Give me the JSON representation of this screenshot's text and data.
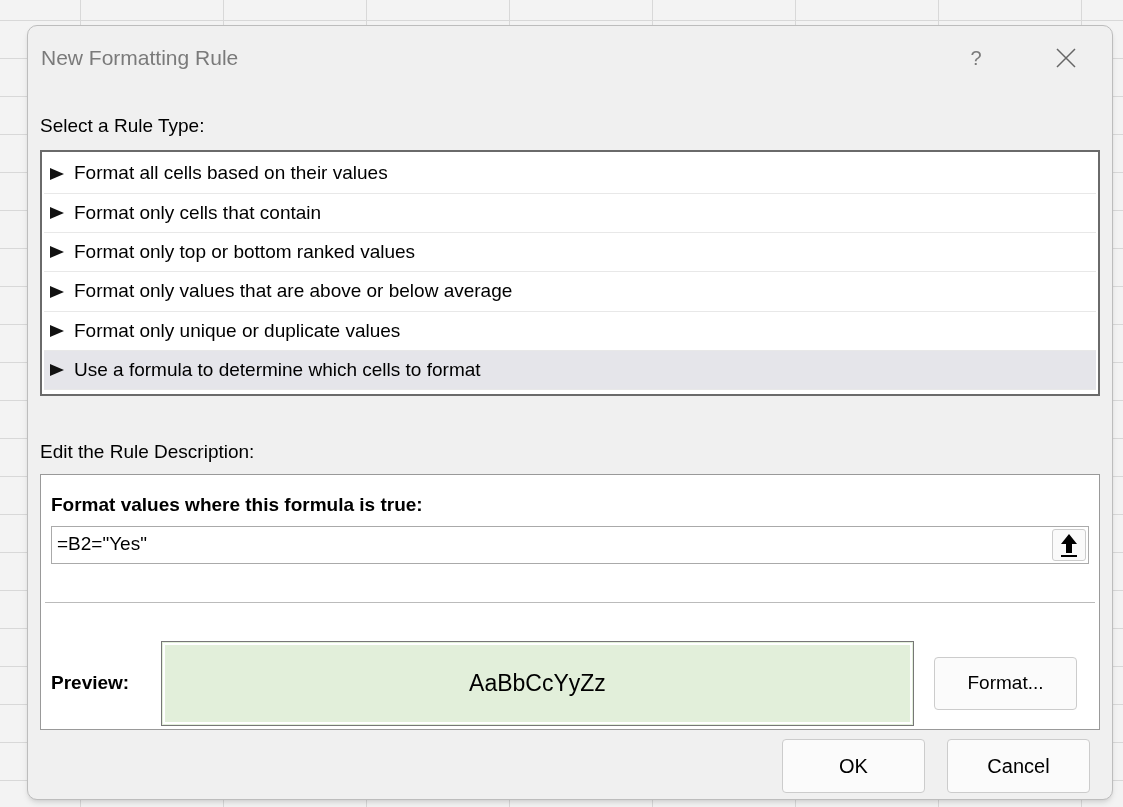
{
  "dialog": {
    "title": "New Formatting Rule",
    "help": "?"
  },
  "rule_type": {
    "label": "Select a Rule Type:",
    "items": [
      {
        "label": "Format all cells based on their values",
        "selected": false
      },
      {
        "label": "Format only cells that contain",
        "selected": false
      },
      {
        "label": "Format only top or bottom ranked values",
        "selected": false
      },
      {
        "label": "Format only values that are above or below average",
        "selected": false
      },
      {
        "label": "Format only unique or duplicate values",
        "selected": false
      },
      {
        "label": "Use a formula to determine which cells to format",
        "selected": true
      }
    ]
  },
  "description": {
    "label": "Edit the Rule Description:",
    "formula_label": "Format values where this formula is true:",
    "formula": "=B2=\"Yes\"",
    "preview_label": "Preview:",
    "preview_text": "AaBbCcYyZz",
    "format_button": "Format..."
  },
  "buttons": [
    "OK",
    "Cancel"
  ]
}
